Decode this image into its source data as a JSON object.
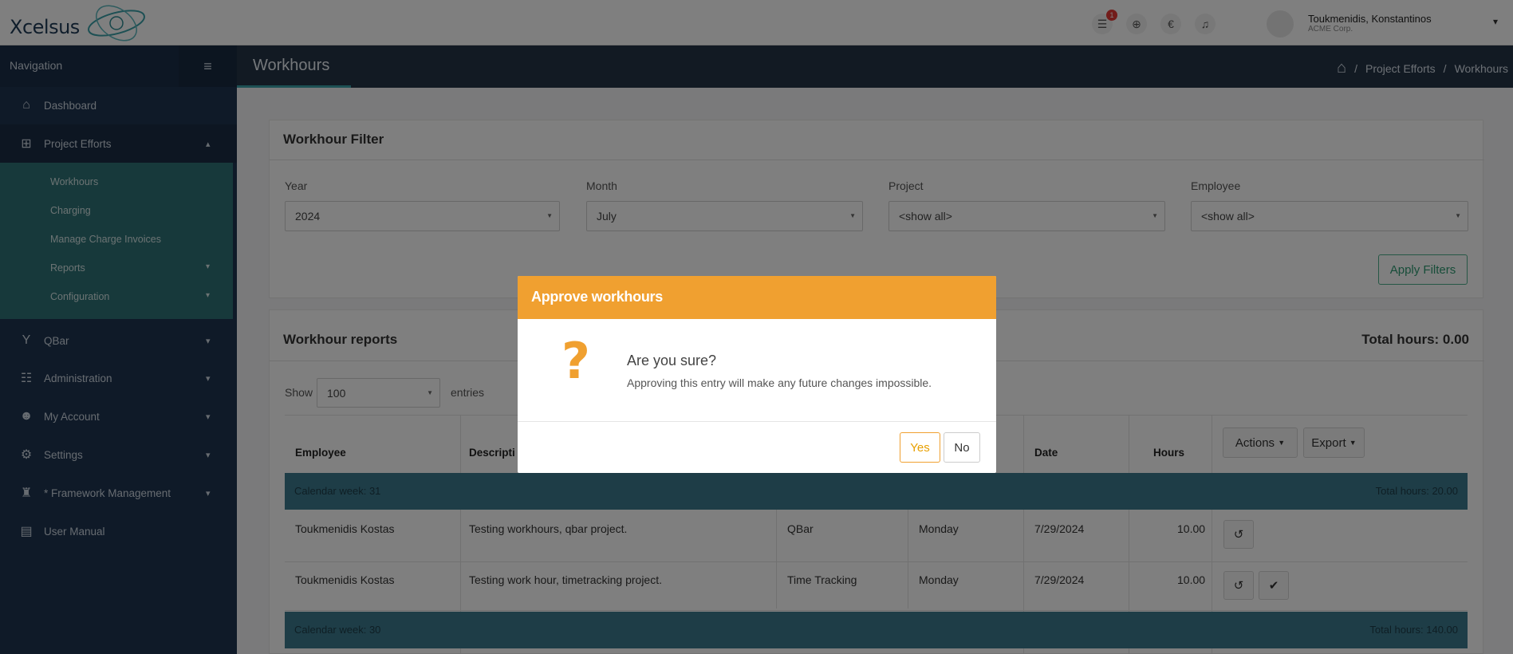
{
  "header": {
    "logo_text": "Xcelsus",
    "notification_count": "1",
    "currency_symbol": "€",
    "user_name": "Toukmenidis, Konstantinos",
    "user_company": "ACME Corp."
  },
  "sidebar": {
    "title": "Navigation",
    "items": [
      {
        "label": "Dashboard",
        "icon": "home-icon"
      },
      {
        "label": "Project Efforts",
        "icon": "sitemap-icon"
      },
      {
        "label": "QBar",
        "icon": "cocktail-icon"
      },
      {
        "label": "Administration",
        "icon": "sliders-icon"
      },
      {
        "label": "My Account",
        "icon": "users-icon"
      },
      {
        "label": "Settings",
        "icon": "gear-icon"
      },
      {
        "label": "* Framework Management",
        "icon": "user-lock-icon"
      },
      {
        "label": "User Manual",
        "icon": "book-icon"
      }
    ],
    "submenu": [
      "Workhours",
      "Charging",
      "Manage Charge Invoices",
      "Reports",
      "Configuration"
    ]
  },
  "page": {
    "title": "Workhours",
    "breadcrumb": [
      "Project Efforts",
      "Workhours"
    ]
  },
  "filter": {
    "title": "Workhour Filter",
    "year_label": "Year",
    "year_value": "2024",
    "month_label": "Month",
    "month_value": "July",
    "project_label": "Project",
    "project_value": "<show all>",
    "employee_label": "Employee",
    "employee_value": "<show all>",
    "apply_label": "Apply Filters"
  },
  "reports": {
    "title": "Workhour reports",
    "total": "Total hours: 0.00",
    "show_label": "Show",
    "show_value": "100",
    "entries_label": "entries",
    "columns": [
      "Employee",
      "Descripti",
      "Date",
      "Hours"
    ],
    "actions_label": "Actions",
    "export_label": "Export",
    "weeks": [
      {
        "label": "Calendar week: 31",
        "total": "Total hours: 20.00"
      },
      {
        "label": "Calendar week: 30",
        "total": "Total hours: 140.00"
      }
    ],
    "rows": [
      {
        "employee": "Toukmenidis Kostas",
        "description": "Testing workhours, qbar project.",
        "project": "QBar",
        "day": "Monday",
        "date": "7/29/2024",
        "hours": "10.00"
      },
      {
        "employee": "Toukmenidis Kostas",
        "description": "Testing work hour, timetracking project.",
        "project": "Time Tracking",
        "day": "Monday",
        "date": "7/29/2024",
        "hours": "10.00"
      }
    ]
  },
  "modal": {
    "title": "Approve workhours",
    "heading": "Are you sure?",
    "message": "Approving this entry will make any future changes impossible.",
    "yes_label": "Yes",
    "no_label": "No",
    "accent_color": "#f0a030"
  }
}
